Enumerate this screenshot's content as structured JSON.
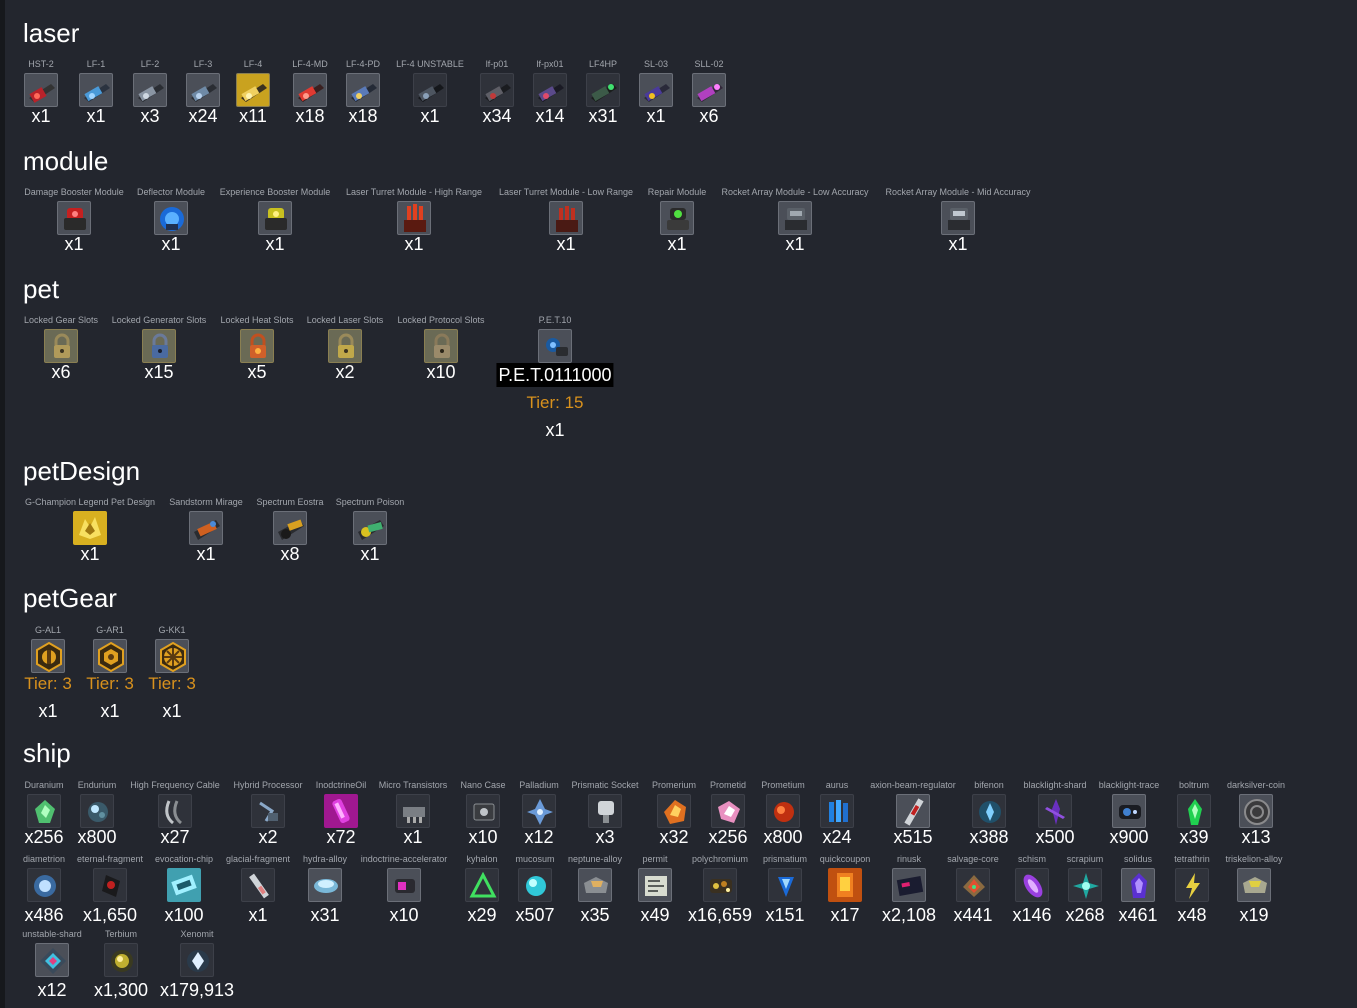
{
  "sections": {
    "laser": {
      "title": "laser",
      "items": [
        {
          "label": "HST-2",
          "count": "x1"
        },
        {
          "label": "LF-1",
          "count": "x1"
        },
        {
          "label": "LF-2",
          "count": "x3"
        },
        {
          "label": "LF-3",
          "count": "x24"
        },
        {
          "label": "LF-4",
          "count": "x11"
        },
        {
          "label": "LF-4-MD",
          "count": "x18"
        },
        {
          "label": "LF-4-PD",
          "count": "x18"
        },
        {
          "label": "LF-4 UNSTABLE",
          "count": "x1"
        },
        {
          "label": "lf-p01",
          "count": "x34"
        },
        {
          "label": "lf-px01",
          "count": "x14"
        },
        {
          "label": "LF4HP",
          "count": "x31"
        },
        {
          "label": "SL-03",
          "count": "x1"
        },
        {
          "label": "SLL-02",
          "count": "x6"
        }
      ]
    },
    "module": {
      "title": "module",
      "items": [
        {
          "label": "Damage Booster Module",
          "count": "x1"
        },
        {
          "label": "Deflector Module",
          "count": "x1"
        },
        {
          "label": "Experience Booster Module",
          "count": "x1"
        },
        {
          "label": "Laser Turret Module - High Range",
          "count": "x1"
        },
        {
          "label": "Laser Turret Module - Low Range",
          "count": "x1"
        },
        {
          "label": "Repair Module",
          "count": "x1"
        },
        {
          "label": "Rocket Array Module - Low Accuracy",
          "count": "x1"
        },
        {
          "label": "Rocket Array Module - Mid Accuracy",
          "count": "x1"
        }
      ]
    },
    "pet": {
      "title": "pet",
      "items": [
        {
          "label": "Locked Gear Slots",
          "count": "x6"
        },
        {
          "label": "Locked Generator Slots",
          "count": "x15"
        },
        {
          "label": "Locked Heat Slots",
          "count": "x5"
        },
        {
          "label": "Locked Laser Slots",
          "count": "x2"
        },
        {
          "label": "Locked Protocol Slots",
          "count": "x10"
        }
      ],
      "special": {
        "label": "P.E.T.10",
        "name": "P.E.T.0111000",
        "tier": "Tier: 15",
        "count": "x1"
      }
    },
    "petDesign": {
      "title": "petDesign",
      "items": [
        {
          "label": "G-Champion Legend Pet Design",
          "count": "x1"
        },
        {
          "label": "Sandstorm Mirage",
          "count": "x1"
        },
        {
          "label": "Spectrum Eostra",
          "count": "x8"
        },
        {
          "label": "Spectrum Poison",
          "count": "x1"
        }
      ]
    },
    "petGear": {
      "title": "petGear",
      "items": [
        {
          "label": "G-AL1",
          "tier": "Tier: 3",
          "count": "x1"
        },
        {
          "label": "G-AR1",
          "tier": "Tier: 3",
          "count": "x1"
        },
        {
          "label": "G-KK1",
          "tier": "Tier: 3",
          "count": "x1"
        }
      ]
    },
    "ship": {
      "title": "ship",
      "row1": [
        {
          "label": "Duranium",
          "count": "x256"
        },
        {
          "label": "Endurium",
          "count": "x800"
        },
        {
          "label": "High Frequency Cable",
          "count": "x27"
        },
        {
          "label": "Hybrid Processor",
          "count": "x2"
        },
        {
          "label": "InodctrineOil",
          "count": "x72"
        },
        {
          "label": "Micro Transistors",
          "count": "x1"
        },
        {
          "label": "Nano Case",
          "count": "x10"
        },
        {
          "label": "Palladium",
          "count": "x12"
        },
        {
          "label": "Prismatic Socket",
          "count": "x3"
        },
        {
          "label": "Promerium",
          "count": "x32"
        },
        {
          "label": "Prometid",
          "count": "x256"
        },
        {
          "label": "Prometium",
          "count": "x800"
        },
        {
          "label": "aurus",
          "count": "x24"
        },
        {
          "label": "axion-beam-regulator",
          "count": "x515"
        },
        {
          "label": "bifenon",
          "count": "x388"
        },
        {
          "label": "blacklight-shard",
          "count": "x500"
        },
        {
          "label": "blacklight-trace",
          "count": "x900"
        },
        {
          "label": "boltrum",
          "count": "x39"
        },
        {
          "label": "darksilver-coin",
          "count": "x13"
        }
      ],
      "row2": [
        {
          "label": "diametrion",
          "count": "x486"
        },
        {
          "label": "eternal-fragment",
          "count": "x1,650"
        },
        {
          "label": "evocation-chip",
          "count": "x100"
        },
        {
          "label": "glacial-fragment",
          "count": "x1"
        },
        {
          "label": "hydra-alloy",
          "count": "x31"
        },
        {
          "label": "indoctrine-accelerator",
          "count": "x10"
        },
        {
          "label": "kyhalon",
          "count": "x29"
        },
        {
          "label": "mucosum",
          "count": "x507"
        },
        {
          "label": "neptune-alloy",
          "count": "x35"
        },
        {
          "label": "permit",
          "count": "x49"
        },
        {
          "label": "polychromium",
          "count": "x16,659"
        },
        {
          "label": "prismatium",
          "count": "x151"
        },
        {
          "label": "quickcoupon",
          "count": "x17"
        },
        {
          "label": "rinusk",
          "count": "x2,108"
        },
        {
          "label": "salvage-core",
          "count": "x441"
        },
        {
          "label": "schism",
          "count": "x146"
        },
        {
          "label": "scrapium",
          "count": "x268"
        },
        {
          "label": "solidus",
          "count": "x461"
        },
        {
          "label": "tetrathrin",
          "count": "x48"
        },
        {
          "label": "triskelion-alloy",
          "count": "x19"
        }
      ],
      "row3": [
        {
          "label": "unstable-shard",
          "count": "x12"
        },
        {
          "label": "Terbium",
          "count": "x1,300"
        },
        {
          "label": "Xenomit",
          "count": "x179,913"
        }
      ]
    }
  },
  "colors": {
    "background": "#23262e",
    "label": "#a2a6ad",
    "tier": "#d8911d",
    "text": "#ffffff"
  },
  "icons": {
    "laser": [
      "red-laser-cannon-icon",
      "blue-laser-cannon-icon",
      "gray-laser-cannon-icon",
      "gray-laser-cannon-icon",
      "gold-laser-cannon-icon",
      "red-laser-cannon-icon",
      "blue-laser-cannon-icon",
      "dark-laser-cannon-icon",
      "gray-laser-cannon-icon",
      "purple-laser-cannon-icon",
      "green-laser-cannon-icon",
      "gold-laser-cannon-icon",
      "pink-laser-cannon-icon"
    ],
    "module": [
      "red-robot-module-icon",
      "blue-shield-module-icon",
      "yellow-robot-module-icon",
      "red-turret-module-icon",
      "red-turret-module-icon",
      "green-robot-module-icon",
      "gray-rocket-module-icon",
      "gray-rocket-module-icon"
    ],
    "pet": [
      "padlock-icon",
      "padlock-icon",
      "fire-padlock-icon",
      "padlock-icon",
      "padlock-icon",
      "pet-drone-icon"
    ],
    "petDesign": [
      "gold-pet-design-icon",
      "orange-pet-design-icon",
      "gold-pet-design-icon",
      "green-pet-design-icon"
    ],
    "petGear": [
      "gear-hex-icon",
      "gear-hex-icon",
      "gear-hex-icon"
    ]
  }
}
